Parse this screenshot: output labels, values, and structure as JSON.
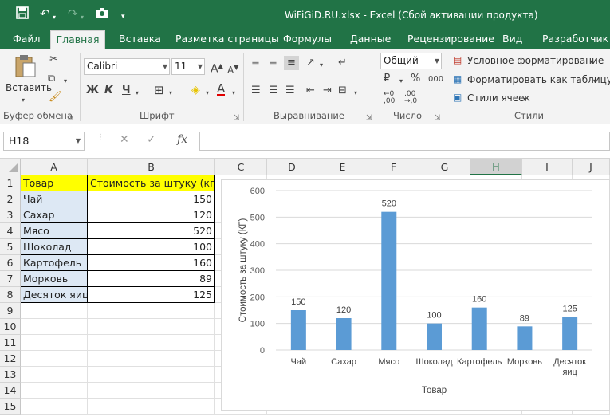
{
  "window": {
    "title": "WiFiGiD.RU.xlsx - Excel (Сбой активации продукта)"
  },
  "tabs": [
    {
      "label": "Файл",
      "active": false
    },
    {
      "label": "Главная",
      "active": true
    },
    {
      "label": "Вставка",
      "active": false
    },
    {
      "label": "Разметка страницы",
      "active": false
    },
    {
      "label": "Формулы",
      "active": false
    },
    {
      "label": "Данные",
      "active": false
    },
    {
      "label": "Рецензирование",
      "active": false
    },
    {
      "label": "Вид",
      "active": false
    },
    {
      "label": "Разработчик",
      "active": false
    }
  ],
  "ribbon": {
    "clipboard": {
      "paste_label": "Вставить",
      "group_label": "Буфер обмена"
    },
    "font": {
      "font_name": "Calibri",
      "font_size": "11",
      "bold": "Ж",
      "italic": "К",
      "underline": "Ч",
      "group_label": "Шрифт"
    },
    "alignment": {
      "group_label": "Выравнивание"
    },
    "number": {
      "format": "Общий",
      "percent": "%",
      "thousands": "000",
      "group_label": "Число"
    },
    "styles": {
      "conditional": "Условное форматирование",
      "as_table": "Форматировать как таблицу",
      "cell_styles": "Стили ячеек",
      "group_label": "Стили"
    }
  },
  "formula_bar": {
    "name_box": "H18",
    "fx": "fx",
    "formula": ""
  },
  "sheet": {
    "columns": [
      "A",
      "B",
      "C",
      "D",
      "E",
      "F",
      "G",
      "H",
      "I",
      "J"
    ],
    "selected_column": "H",
    "rows": [
      "1",
      "2",
      "3",
      "4",
      "5",
      "6",
      "7",
      "8",
      "9",
      "10",
      "11",
      "12",
      "13",
      "14",
      "15"
    ],
    "header": {
      "a": "Товар",
      "b": "Стоимость за штуку (кг)"
    },
    "data": [
      {
        "a": "Чай",
        "b": "150"
      },
      {
        "a": "Сахар",
        "b": "120"
      },
      {
        "a": "Мясо",
        "b": "520"
      },
      {
        "a": "Шоколад",
        "b": "100"
      },
      {
        "a": "Картофель",
        "b": "160"
      },
      {
        "a": "Морковь",
        "b": "89"
      },
      {
        "a": "Десяток яиц",
        "b": "125"
      }
    ],
    "header_fill": "#ffff00",
    "column_a_fill": "#dde8f4"
  },
  "chart_data": {
    "type": "bar",
    "categories": [
      "Чай",
      "Сахар",
      "Мясо",
      "Шоколад",
      "Картофель",
      "Морковь",
      "Десяток яиц"
    ],
    "values": [
      150,
      120,
      520,
      100,
      160,
      89,
      125
    ],
    "title": "",
    "xlabel": "Товар",
    "ylabel": "Стоимость за штуку (КГ)",
    "ylim": [
      0,
      600
    ],
    "yticks": [
      0,
      100,
      200,
      300,
      400,
      500,
      600
    ],
    "grid": true,
    "bar_color": "#5b9bd5"
  },
  "colors": {
    "brand": "#217346"
  }
}
